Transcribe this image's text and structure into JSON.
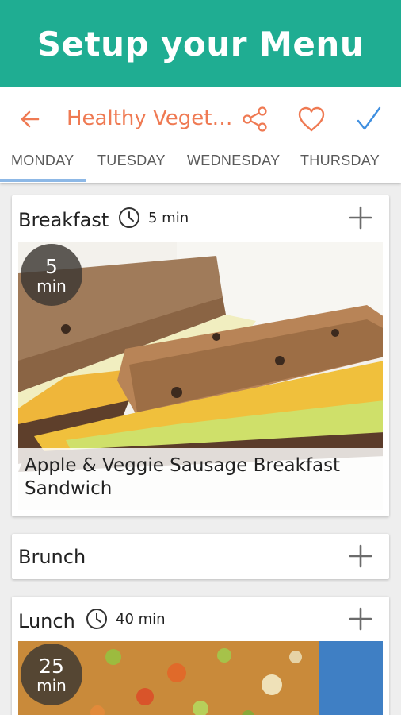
{
  "banner": {
    "title": "Setup your Menu"
  },
  "toolbar": {
    "title": "Healthy Vegetarian Menu",
    "colors": {
      "accent": "#ef7a53",
      "confirm": "#3f8fe0",
      "banner": "#1fad92"
    }
  },
  "tabs": [
    {
      "label": "MONDAY",
      "selected": true
    },
    {
      "label": "TUESDAY",
      "selected": false
    },
    {
      "label": "WEDNESDAY",
      "selected": false
    },
    {
      "label": "THURSDAY",
      "selected": false
    }
  ],
  "meals": {
    "breakfast": {
      "name": "Breakfast",
      "time": "5 min",
      "badge_number": "5",
      "badge_unit": "min",
      "recipe": "Apple & Veggie Sausage Breakfast Sandwich",
      "icons": [
        "clock-icon",
        "add-icon"
      ]
    },
    "brunch": {
      "name": "Brunch",
      "icons": [
        "add-icon"
      ]
    },
    "lunch": {
      "name": "Lunch",
      "time": "40 min",
      "badge_number": "25",
      "badge_unit": "min",
      "icons": [
        "clock-icon",
        "add-icon"
      ]
    }
  }
}
